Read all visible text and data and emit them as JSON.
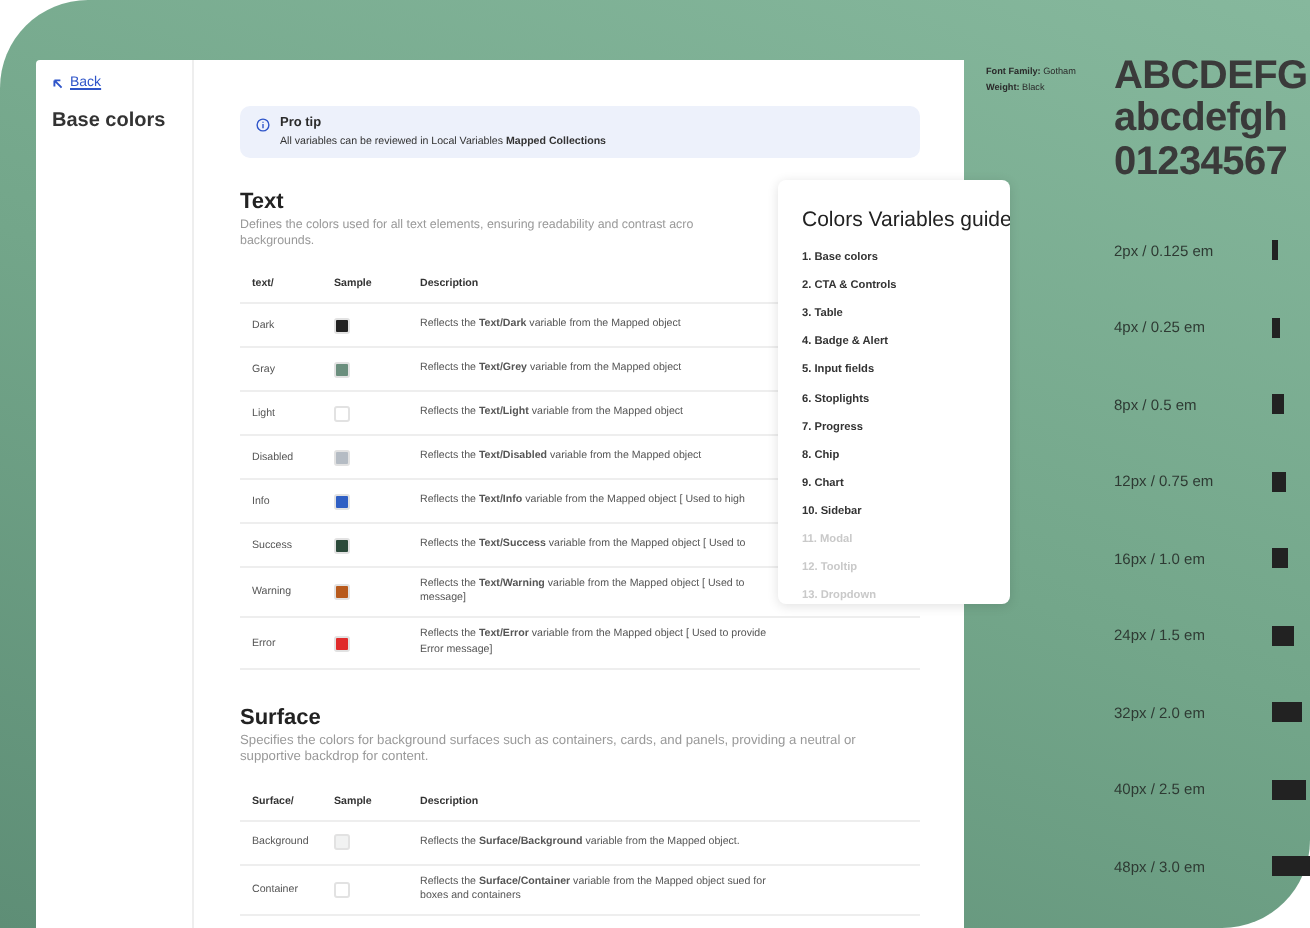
{
  "sidebar": {
    "back_link": "Back",
    "title": "Base colors"
  },
  "pro_tip": {
    "title": "Pro tip",
    "text": "All variables can be reviewed  in Local Variables **Mapped Collections**"
  },
  "sections": [
    {
      "title": "Text",
      "description": "Defines the colors used for all text elements, ensuring readability and contrast acro",
      "description_continuation": "backgrounds.",
      "columns": [
        "text/",
        "Sample",
        "Description"
      ],
      "rows": [
        {
          "name": "Dark",
          "color": "#222222",
          "description": "Reflects the **Text/Dark** variable from the Mapped object"
        },
        {
          "name": "Gray",
          "color": "#6b8f7e",
          "description": "Reflects the **Text/Grey** variable from the Mapped object"
        },
        {
          "name": "Light",
          "color": "#ffffff",
          "description": "Reflects the **Text/Light** variable from the Mapped object"
        },
        {
          "name": "Disabled",
          "color": "#b5bcc4",
          "description": "Reflects the **Text/Disabled** variable from the Mapped object"
        },
        {
          "name": "Info",
          "color": "#2f5fc4",
          "description": "Reflects the **Text/Info** variable from the Mapped object [ Used to high"
        },
        {
          "name": "Success",
          "color": "#2b4a3a",
          "description": "Reflects the **Text/Success** variable from the Mapped object [ Used to"
        },
        {
          "name": "Warning",
          "color": "#b85a1c",
          "description": "Reflects the **Text/Warning** variable from the Mapped object [ Used to",
          "continuation": "message]"
        },
        {
          "name": "Error",
          "color": "#e02b2b",
          "description": "Reflects the **Text/Error** variable from the Mapped object [ Used to provide Error message]"
        }
      ]
    },
    {
      "title": "Surface",
      "description": "Specifies the colors for background surfaces such as containers, cards, and panels, providing a neutral or supportive backdrop for content.",
      "columns": [
        "Surface/",
        "Sample",
        "Description"
      ],
      "rows": [
        {
          "name": "Background",
          "color": "#f1f2f2",
          "description": "Reflects the **Surface/Background** variable from the Mapped object."
        },
        {
          "name": "Container",
          "color": "#ffffff",
          "description": "Reflects the **Surface/Container** variable from the Mapped object sued for boxes and containers"
        }
      ]
    }
  ],
  "guide": {
    "title": "Colors Variables guide",
    "items": [
      {
        "label": "1. Base colors",
        "disabled": false
      },
      {
        "label": "2. CTA & Controls",
        "disabled": false
      },
      {
        "label": "3. Table",
        "disabled": false
      },
      {
        "label": "4. Badge & Alert",
        "disabled": false
      },
      {
        "label": "5. Input fields",
        "disabled": false
      },
      {
        "label": "6. Stoplights",
        "disabled": false
      },
      {
        "label": "7. Progress",
        "disabled": false
      },
      {
        "label": "8. Chip",
        "disabled": false
      },
      {
        "label": "9. Chart",
        "disabled": false
      },
      {
        "label": "10. Sidebar",
        "disabled": false
      },
      {
        "label": "11. Modal",
        "disabled": true
      },
      {
        "label": "12. Tooltip",
        "disabled": true
      },
      {
        "label": "13. Dropdown",
        "disabled": true
      }
    ]
  },
  "typography": {
    "font_family_label": "Font Family:",
    "font_family": "Gotham",
    "weight_label": "Weight:",
    "weight": "Black",
    "samples": [
      "ABCDEFG",
      "abcdefgh",
      "01234567"
    ]
  },
  "spacing": [
    "2px / 0.125 em",
    "4px / 0.25 em",
    "8px  / 0.5 em",
    "12px  / 0.75 em",
    "16px  / 1.0 em",
    "24px  / 1.5 em",
    "32px  / 2.0 em",
    "40px  / 2.5 em",
    "48px  / 3.0 em"
  ]
}
